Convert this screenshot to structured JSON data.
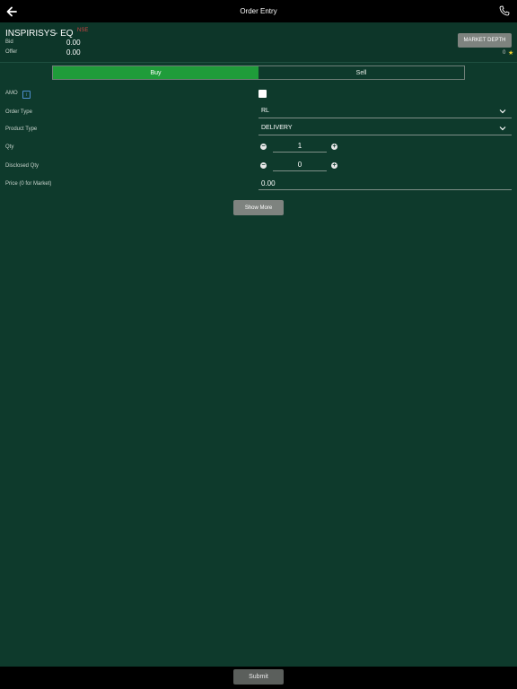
{
  "topbar": {
    "title": "Order Entry",
    "back_icon": "arrow-left-icon",
    "call_icon": "phone-icon"
  },
  "instrument": {
    "symbol": "INSPIRISYS",
    "series": "- EQ",
    "exchange": "NSE",
    "bid_label": "Bid",
    "bid_value": "0.00",
    "offer_label": "Offer",
    "offer_value": "0.00",
    "market_depth_label": "MARKET DEPTH",
    "favorite_count": "0"
  },
  "side": {
    "options": [
      "Buy",
      "Sell"
    ],
    "selected": "Buy"
  },
  "form": {
    "amo_label": "AMO",
    "amo_checked": false,
    "order_type_label": "Order Type",
    "order_type_value": "RL",
    "product_type_label": "Product Type",
    "product_type_value": "DELIVERY",
    "qty_label": "Qty",
    "qty_value": "1",
    "disclosed_qty_label": "Disclosed Qty",
    "disclosed_qty_value": "0",
    "price_label": "Price (0 for Market)",
    "price_value": "0.00"
  },
  "actions": {
    "show_more": "Show More",
    "submit": "Submit"
  },
  "colors": {
    "background": "#0e3a2c",
    "buy": "#1f9c3a",
    "bar": "#000000",
    "button": "#7e837f"
  }
}
